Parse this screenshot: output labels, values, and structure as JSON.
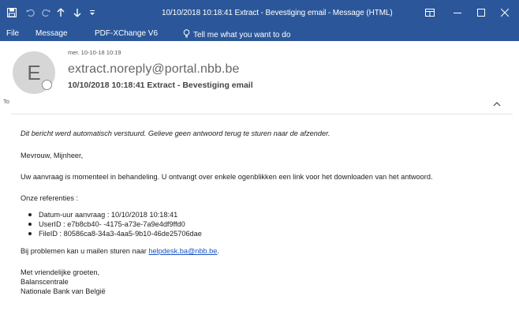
{
  "window": {
    "title": "10/10/2018 10:18:41 Extract - Bevestiging email  -  Message (HTML)"
  },
  "quick_access": {
    "icons": [
      "save-icon",
      "undo-icon",
      "redo-icon",
      "up-arrow-icon",
      "down-arrow-icon",
      "customize-icon"
    ]
  },
  "window_controls": {
    "icons": [
      "ribbon-display-icon",
      "minimize-icon",
      "maximize-icon",
      "close-icon"
    ]
  },
  "menu": {
    "file": "File",
    "message": "Message",
    "pdf": "PDF-XChange V6",
    "tell": "Tell me what you want to do"
  },
  "header": {
    "avatar_initial": "E",
    "date": "mer. 10-10-18 10:19",
    "sender": "extract.noreply@portal.nbb.be",
    "subject": "10/10/2018 10:18:41 Extract - Bevestiging email",
    "to_label": "To"
  },
  "body": {
    "notice": "Dit bericht werd automatisch verstuurd. Gelieve geen antwoord terug te sturen naar de afzender.",
    "greeting": "Mevrouw, Mijnheer,",
    "status": "Uw aanvraag is momenteel in behandeling. U ontvangt over enkele ogenblikken een link voor het downloaden van het antwoord.",
    "refs_title": "Onze referenties :",
    "refs": [
      "Datum-uur aanvraag : 10/10/2018 10:18:41",
      "UserID : e7b8cb40-        -4175-a73e-7a9e4df9ffd0",
      "FileID : 80586ca8-34a3-4aa5-9b10-46de25706dae"
    ],
    "problems_text": "Bij problemen kan u mailen sturen naar ",
    "helpdesk_email": "helpdesk.ba@nbb.be",
    "problems_end": ".",
    "sign_1": "Met vriendelijke groeten,",
    "sign_2": "Balanscentrale",
    "sign_3": "Nationale Bank van België"
  },
  "colors": {
    "accent": "#2b579a",
    "link": "#1a54c4"
  }
}
